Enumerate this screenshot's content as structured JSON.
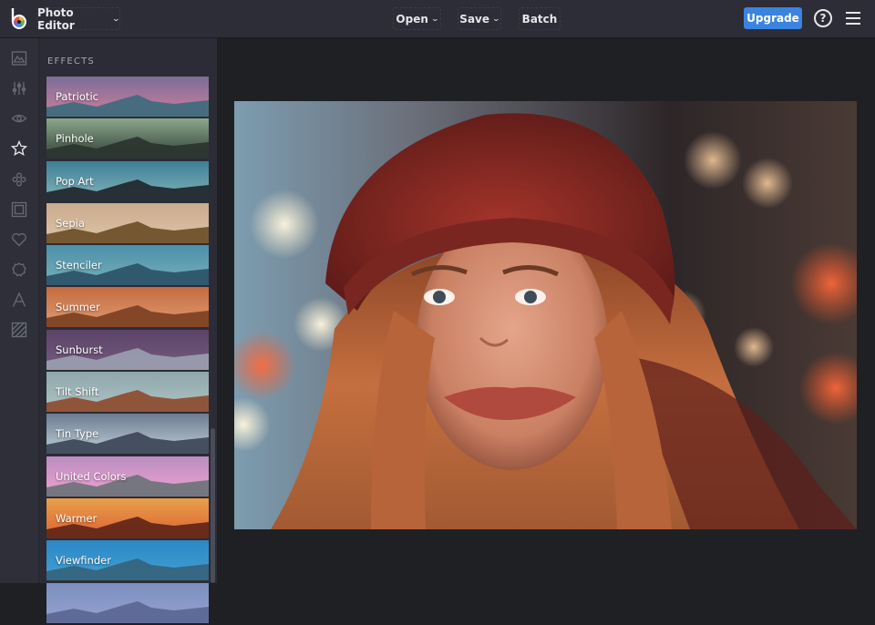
{
  "topbar": {
    "app_menu": "Photo Editor",
    "open_label": "Open",
    "save_label": "Save",
    "batch_label": "Batch",
    "upgrade_label": "Upgrade",
    "help_glyph": "?"
  },
  "iconbar": [
    {
      "name": "basic-edits",
      "icon": "image-icon"
    },
    {
      "name": "adjustments",
      "icon": "sliders-icon"
    },
    {
      "name": "touch-up",
      "icon": "eye-icon"
    },
    {
      "name": "effects",
      "icon": "star-icon",
      "active": true
    },
    {
      "name": "graphics",
      "icon": "flower-icon"
    },
    {
      "name": "frames",
      "icon": "frame-icon"
    },
    {
      "name": "overlays",
      "icon": "heart-icon"
    },
    {
      "name": "stickers",
      "icon": "badge-icon"
    },
    {
      "name": "text",
      "icon": "text-icon"
    },
    {
      "name": "textures",
      "icon": "texture-icon"
    }
  ],
  "panel": {
    "title": "EFFECTS",
    "effects": [
      {
        "label": "Patriotic",
        "sky": "#7a6d99",
        "sky2": "#b57a9b",
        "ground": "#3c6a7c"
      },
      {
        "label": "Pinhole",
        "sky": "#8ca78d",
        "sky2": "#4b5e4e",
        "ground": "#2a3330"
      },
      {
        "label": "Pop Art",
        "sky": "#3e7f96",
        "sky2": "#6ea5ae",
        "ground": "#1e2429"
      },
      {
        "label": "Sepia",
        "sky": "#c9ab8d",
        "sky2": "#d8bda0",
        "ground": "#6a4d26"
      },
      {
        "label": "Stenciler",
        "sky": "#4c90a8",
        "sky2": "#6aa6b6",
        "ground": "#2b5166"
      },
      {
        "label": "Summer",
        "sky": "#c66a3f",
        "sky2": "#d88d62",
        "ground": "#7a3f22"
      },
      {
        "label": "Sunburst",
        "sky": "#5a4466",
        "sky2": "#6d5479",
        "ground": "#9aa0b0"
      },
      {
        "label": "Tilt Shift",
        "sky": "#8ea7ab",
        "sky2": "#a6bbbd",
        "ground": "#8d4a2c"
      },
      {
        "label": "Tin Type",
        "sky": "#6d7c91",
        "sky2": "#a6b6c2",
        "ground": "#3b4455"
      },
      {
        "label": "United Colors",
        "sky": "#b98ebf",
        "sky2": "#e09bcd",
        "ground": "#6a7279"
      },
      {
        "label": "Warmer",
        "sky": "#e8a04a",
        "sky2": "#e0743a",
        "ground": "#5e2418"
      },
      {
        "label": "Viewfinder",
        "sky": "#2c87c4",
        "sky2": "#3c99cf",
        "ground": "#35627a"
      },
      {
        "label": "",
        "sky": "#7a8fc0",
        "sky2": "#8e9ccb",
        "ground": "#5a6690"
      }
    ]
  },
  "canvas": {
    "subject": "portrait of woman with red knit beanie and long wavy auburn hair, bokeh city lights background"
  }
}
